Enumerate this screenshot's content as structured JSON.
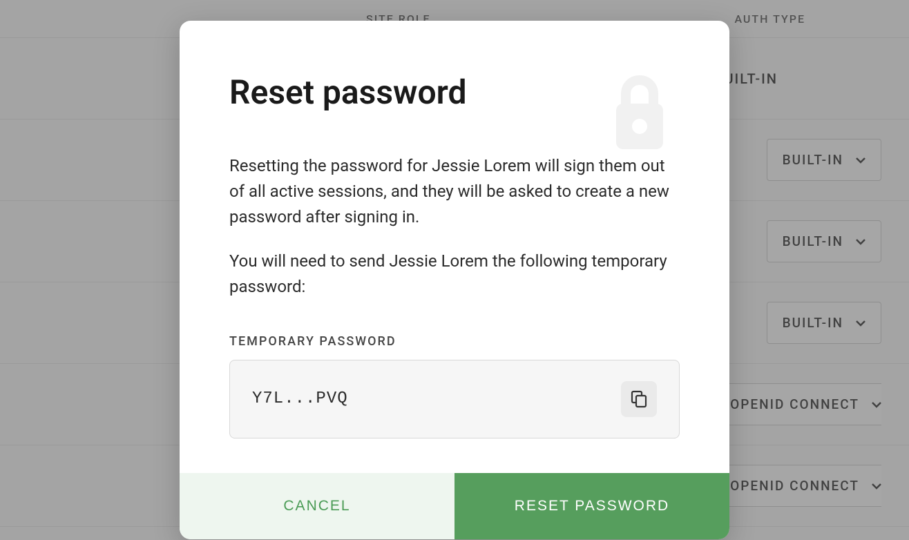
{
  "background": {
    "columns": {
      "site_role": "SITE ROLE",
      "auth_type": "AUTH TYPE"
    },
    "first_row_auth": "BUILT-IN",
    "auth_options": [
      "BUILT-IN",
      "BUILT-IN",
      "BUILT-IN",
      "OPENID CONNECT",
      "OPENID CONNECT"
    ]
  },
  "modal": {
    "title": "Reset password",
    "paragraph1": "Resetting the password for Jessie Lorem will sign them out of all active sessions, and they will be asked to create a new password after signing in.",
    "paragraph2": "You will need to send Jessie Lorem the following temporary password:",
    "temp_label": "TEMPORARY PASSWORD",
    "temp_value": "Y7L...PVQ",
    "cancel_label": "CANCEL",
    "confirm_label": "RESET PASSWORD"
  }
}
